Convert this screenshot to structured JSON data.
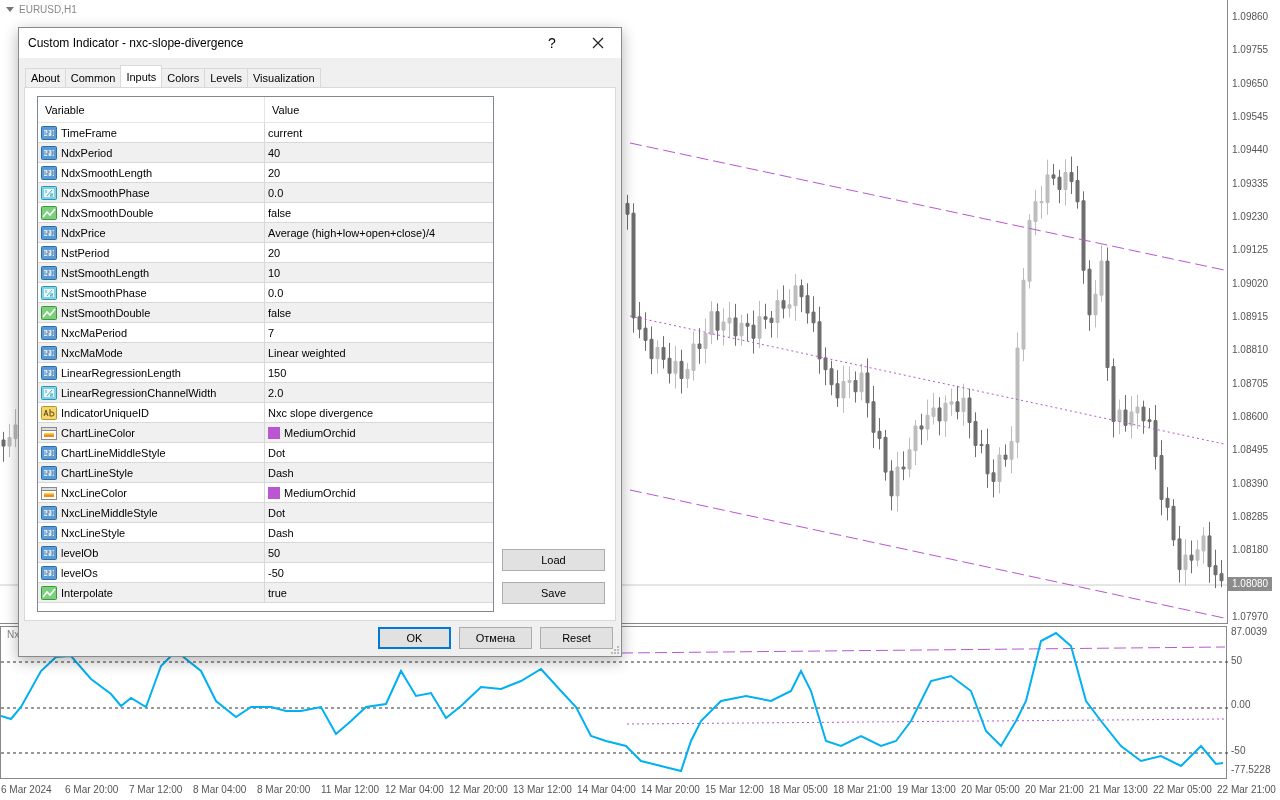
{
  "chart": {
    "symbol": "EURUSD,H1",
    "price_axis": [
      {
        "kind": "tick",
        "label": "1.09860"
      },
      {
        "kind": "tick",
        "label": "1.09755"
      },
      {
        "kind": "tick",
        "label": "1.09650"
      },
      {
        "kind": "tick",
        "label": "1.09545"
      },
      {
        "kind": "tick",
        "label": "1.09440"
      },
      {
        "kind": "tick",
        "label": "1.09335"
      },
      {
        "kind": "tick",
        "label": "1.09230"
      },
      {
        "kind": "tick",
        "label": "1.09125"
      },
      {
        "kind": "tick",
        "label": "1.09020"
      },
      {
        "kind": "tick",
        "label": "1.08915"
      },
      {
        "kind": "tick",
        "label": "1.08810"
      },
      {
        "kind": "tick",
        "label": "1.08705"
      },
      {
        "kind": "tick",
        "label": "1.08600"
      },
      {
        "kind": "tick",
        "label": "1.08495"
      },
      {
        "kind": "tick",
        "label": "1.08390"
      },
      {
        "kind": "tick",
        "label": "1.08285"
      },
      {
        "kind": "tick",
        "label": "1.08180"
      },
      {
        "kind": "current",
        "label": "1.08080"
      },
      {
        "kind": "tick",
        "label": "1.07970"
      }
    ],
    "indicator_label": "Nx",
    "indicator_axis": [
      "87.0039",
      "50",
      "0.00",
      "-50",
      "-77.5228"
    ],
    "time_axis": [
      "6 Mar 2024",
      "6 Mar 20:00",
      "7 Mar 12:00",
      "8 Mar 04:00",
      "8 Mar 20:00",
      "11 Mar 12:00",
      "12 Mar 04:00",
      "12 Mar 20:00",
      "13 Mar 12:00",
      "14 Mar 04:00",
      "14 Mar 20:00",
      "15 Mar 12:00",
      "18 Mar 05:00",
      "18 Mar 21:00",
      "19 Mar 13:00",
      "20 Mar 05:00",
      "20 Mar 21:00",
      "21 Mar 13:00",
      "22 Mar 05:00",
      "22 Mar 21:00"
    ]
  },
  "dialog": {
    "title": "Custom Indicator - nxc-slope-divergence",
    "help": "?",
    "tabs": [
      {
        "label": "About",
        "selected": false
      },
      {
        "label": "Common",
        "selected": false
      },
      {
        "label": "Inputs",
        "selected": true
      },
      {
        "label": "Colors",
        "selected": false
      },
      {
        "label": "Levels",
        "selected": false
      },
      {
        "label": "Visualization",
        "selected": false
      }
    ],
    "table": {
      "columns": [
        "Variable",
        "Value"
      ],
      "rows": [
        {
          "kind": "int",
          "name": "TimeFrame",
          "value": "current"
        },
        {
          "kind": "int",
          "name": "NdxPeriod",
          "value": "40"
        },
        {
          "kind": "int",
          "name": "NdxSmoothLength",
          "value": "20"
        },
        {
          "kind": "double",
          "name": "NdxSmoothPhase",
          "value": "0.0"
        },
        {
          "kind": "bool",
          "name": "NdxSmoothDouble",
          "value": "false"
        },
        {
          "kind": "int",
          "name": "NdxPrice",
          "value": "Average (high+low+open+close)/4"
        },
        {
          "kind": "int",
          "name": "NstPeriod",
          "value": "20"
        },
        {
          "kind": "int",
          "name": "NstSmoothLength",
          "value": "10"
        },
        {
          "kind": "double",
          "name": "NstSmoothPhase",
          "value": "0.0"
        },
        {
          "kind": "bool",
          "name": "NstSmoothDouble",
          "value": "false"
        },
        {
          "kind": "int",
          "name": "NxcMaPeriod",
          "value": "7"
        },
        {
          "kind": "int",
          "name": "NxcMaMode",
          "value": "Linear weighted"
        },
        {
          "kind": "int",
          "name": "LinearRegressionLength",
          "value": "150"
        },
        {
          "kind": "double",
          "name": "LinearRegressionChannelWidth",
          "value": "2.0"
        },
        {
          "kind": "string",
          "name": "IndicatorUniqueID",
          "value": "Nxc slope divergence"
        },
        {
          "kind": "color",
          "name": "ChartLineColor",
          "value": "MediumOrchid",
          "color": "#ba55d3"
        },
        {
          "kind": "int",
          "name": "ChartLineMiddleStyle",
          "value": "Dot"
        },
        {
          "kind": "int",
          "name": "ChartLineStyle",
          "value": "Dash"
        },
        {
          "kind": "color",
          "name": "NxcLineColor",
          "value": "MediumOrchid",
          "color": "#ba55d3"
        },
        {
          "kind": "int",
          "name": "NxcLineMiddleStyle",
          "value": "Dot"
        },
        {
          "kind": "int",
          "name": "NxcLineStyle",
          "value": "Dash"
        },
        {
          "kind": "int",
          "name": "levelOb",
          "value": "50"
        },
        {
          "kind": "int",
          "name": "levelOs",
          "value": "-50"
        },
        {
          "kind": "bool",
          "name": "Interpolate",
          "value": "true"
        }
      ]
    },
    "side_buttons": [
      "Load",
      "Save"
    ],
    "buttons": [
      {
        "label": "OK",
        "default": true
      },
      {
        "label": "Отмена",
        "default": false
      },
      {
        "label": "Reset",
        "default": false
      }
    ]
  }
}
